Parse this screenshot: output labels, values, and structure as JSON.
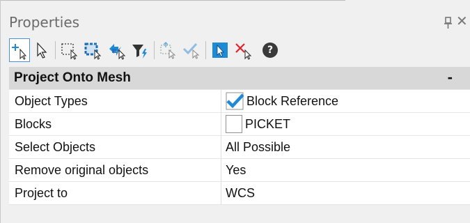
{
  "window": {
    "title": "Properties",
    "close_glyph": "✕"
  },
  "toolbar": {
    "buttons": [
      {
        "icon": "add-selection-icon",
        "active": true
      },
      {
        "icon": "select-pointer-icon"
      },
      {
        "icon": "window-select-icon"
      },
      {
        "icon": "crossing-select-icon"
      },
      {
        "icon": "swap-selection-icon"
      },
      {
        "icon": "filter-icon"
      },
      {
        "icon": "pick-region-icon"
      },
      {
        "icon": "accept-selection-icon"
      },
      {
        "icon": "select-tool-icon"
      },
      {
        "icon": "clear-selection-icon"
      },
      {
        "icon": "help-icon",
        "label": "?"
      }
    ]
  },
  "section": {
    "title": "Project Onto Mesh",
    "collapse_glyph": "-"
  },
  "properties": [
    {
      "key": "Object Types",
      "value": "Block Reference",
      "checkbox": "checked"
    },
    {
      "key": "Blocks",
      "value": "PICKET",
      "checkbox": "unchecked"
    },
    {
      "key": "Select Objects",
      "value": "All Possible"
    },
    {
      "key": "Remove original objects",
      "value": "Yes"
    },
    {
      "key": "Project to",
      "value": "WCS"
    }
  ],
  "colors": {
    "accent": "#1e8ad6",
    "clear_red": "#e0242b"
  }
}
